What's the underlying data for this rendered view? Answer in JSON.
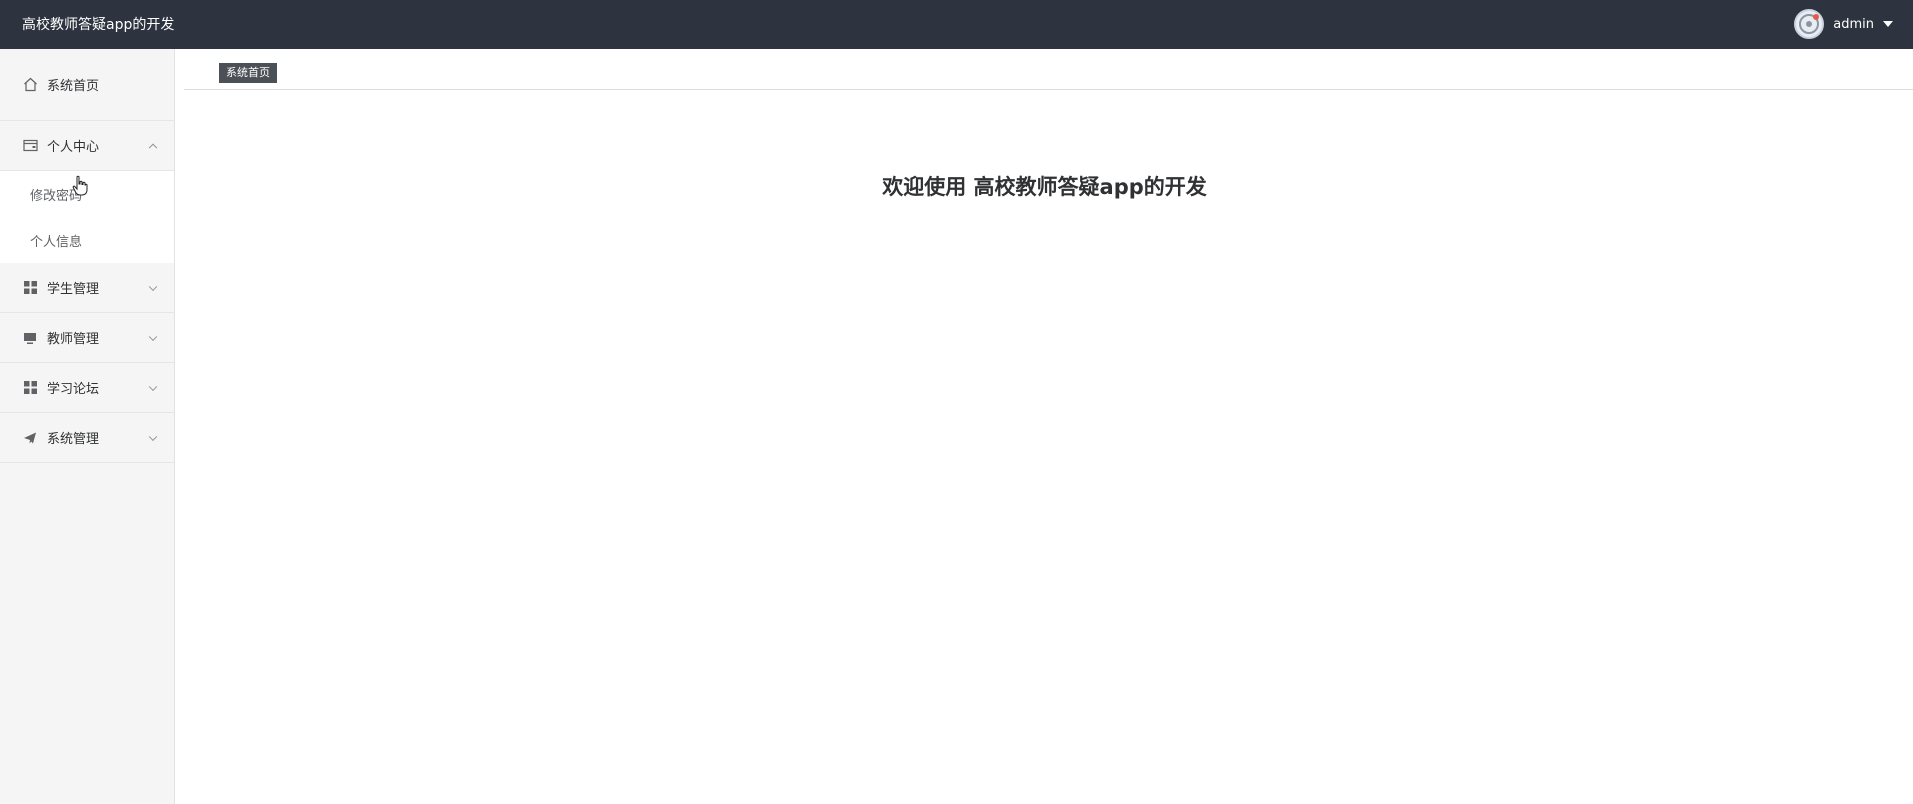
{
  "header": {
    "title": "高校教师答疑app的开发",
    "username": "admin"
  },
  "sidebar": {
    "items": [
      {
        "label": "系统首页",
        "icon": "home-icon",
        "expanded": false
      },
      {
        "label": "个人中心",
        "icon": "wallet-icon",
        "expanded": true,
        "children": [
          "修改密码",
          "个人信息"
        ]
      },
      {
        "label": "学生管理",
        "icon": "grid-icon",
        "expanded": false
      },
      {
        "label": "教师管理",
        "icon": "monitor-icon",
        "expanded": false
      },
      {
        "label": "学习论坛",
        "icon": "grid-icon",
        "expanded": false
      },
      {
        "label": "系统管理",
        "icon": "paper-plane-icon",
        "expanded": false
      }
    ]
  },
  "breadcrumb": {
    "current": "系统首页"
  },
  "main": {
    "welcome": "欢迎使用 高校教师答疑app的开发"
  },
  "colors": {
    "topbar": "#2d3440",
    "sidebar": "#f5f5f5",
    "breadcrumb_tag": "#4b5157"
  }
}
